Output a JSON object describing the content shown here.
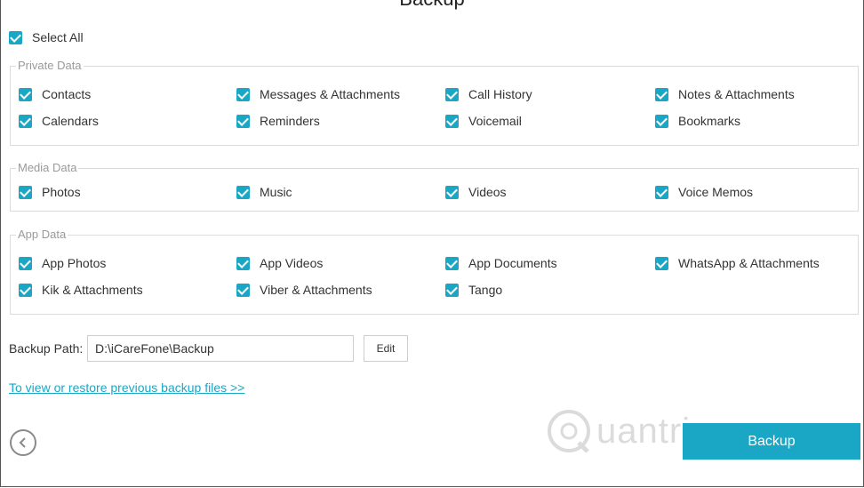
{
  "header": {
    "title": "Backup"
  },
  "select_all": {
    "label": "Select All",
    "checked": true
  },
  "groups": [
    {
      "legend": "Private Data",
      "items": [
        {
          "label": "Contacts",
          "checked": true
        },
        {
          "label": "Messages & Attachments",
          "checked": true
        },
        {
          "label": "Call History",
          "checked": true
        },
        {
          "label": "Notes & Attachments",
          "checked": true
        },
        {
          "label": "Calendars",
          "checked": true
        },
        {
          "label": "Reminders",
          "checked": true
        },
        {
          "label": "Voicemail",
          "checked": true
        },
        {
          "label": "Bookmarks",
          "checked": true
        }
      ]
    },
    {
      "legend": "Media Data",
      "items": [
        {
          "label": "Photos",
          "checked": true
        },
        {
          "label": "Music",
          "checked": true
        },
        {
          "label": "Videos",
          "checked": true
        },
        {
          "label": "Voice Memos",
          "checked": true
        }
      ]
    },
    {
      "legend": "App Data",
      "items": [
        {
          "label": "App Photos",
          "checked": true
        },
        {
          "label": "App Videos",
          "checked": true
        },
        {
          "label": "App Documents",
          "checked": true
        },
        {
          "label": "WhatsApp & Attachments",
          "checked": true
        },
        {
          "label": "Kik & Attachments",
          "checked": true
        },
        {
          "label": "Viber & Attachments",
          "checked": true
        },
        {
          "label": "Tango",
          "checked": true
        }
      ]
    }
  ],
  "backup_path": {
    "label": "Backup Path:",
    "value": "D:\\iCareFone\\Backup",
    "edit_label": "Edit"
  },
  "restore_link": "To view or restore previous backup files >>",
  "watermark": "uantrimang",
  "backup_button": "Backup",
  "icons": {
    "back": "chevron-left-icon",
    "check": "checkmark-icon",
    "watermark": "quantrimang-logo"
  },
  "colors": {
    "accent": "#1aa7c6",
    "border": "#dcdcdc",
    "legend": "#9a9a9a"
  }
}
